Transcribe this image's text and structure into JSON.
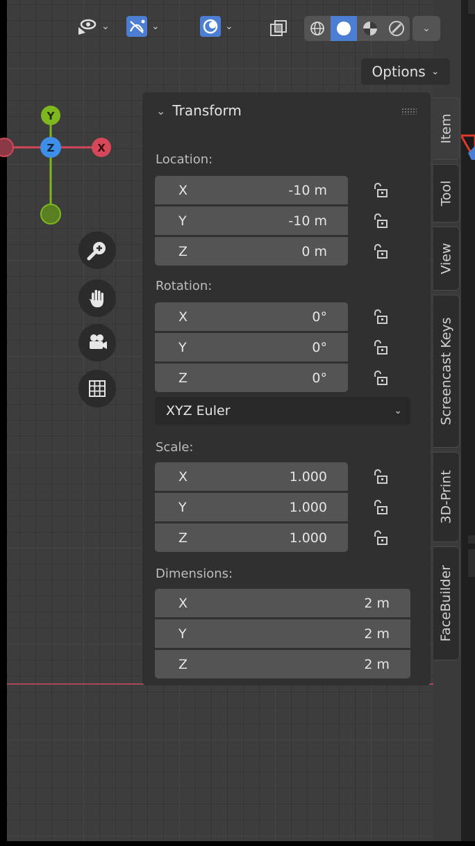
{
  "header": {
    "options_label": "Options",
    "icons": [
      "visibility-icon",
      "gizmo-icon",
      "overlays-icon",
      "xray-icon",
      "wireframe-icon",
      "solid-icon",
      "material-preview-icon",
      "rendered-icon"
    ],
    "accent_color": "#4c7fd4"
  },
  "gizmo": {
    "y_label": "Y",
    "z_label": "Z",
    "x_label": "X",
    "colors": {
      "x": "#d4485a",
      "y": "#7fb81e",
      "z": "#3d8fe8"
    }
  },
  "nav_buttons": [
    "zoom-icon",
    "pan-hand-icon",
    "camera-view-icon",
    "ortho-grid-icon"
  ],
  "transform": {
    "title": "Transform",
    "location_label": "Location:",
    "location": [
      {
        "axis": "X",
        "value": "-10 m"
      },
      {
        "axis": "Y",
        "value": "-10 m"
      },
      {
        "axis": "Z",
        "value": "0 m"
      }
    ],
    "rotation_label": "Rotation:",
    "rotation": [
      {
        "axis": "X",
        "value": "0°"
      },
      {
        "axis": "Y",
        "value": "0°"
      },
      {
        "axis": "Z",
        "value": "0°"
      }
    ],
    "rotation_mode": "XYZ Euler",
    "scale_label": "Scale:",
    "scale": [
      {
        "axis": "X",
        "value": "1.000"
      },
      {
        "axis": "Y",
        "value": "1.000"
      },
      {
        "axis": "Z",
        "value": "1.000"
      }
    ],
    "dimensions_label": "Dimensions:",
    "dimensions": [
      {
        "axis": "X",
        "value": "2 m"
      },
      {
        "axis": "Y",
        "value": "2 m"
      },
      {
        "axis": "Z",
        "value": "2 m"
      }
    ]
  },
  "tabs": [
    "Item",
    "Tool",
    "View",
    "Screencast Keys",
    "3D-Print",
    "FaceBuilder"
  ],
  "active_tab": "Item"
}
